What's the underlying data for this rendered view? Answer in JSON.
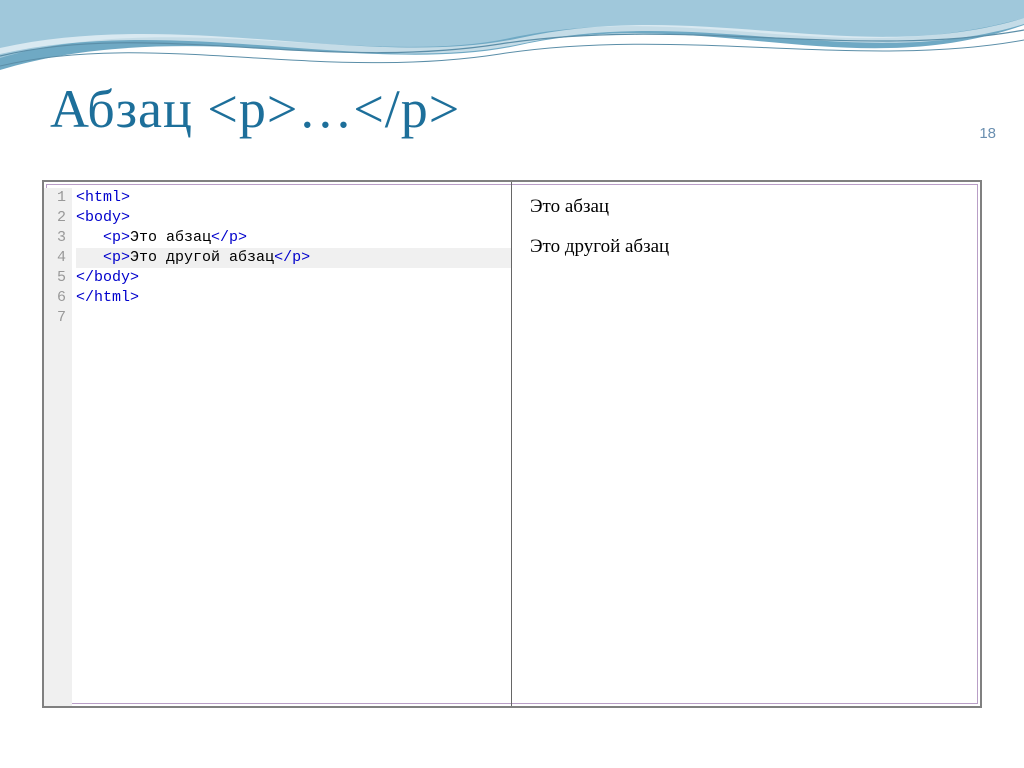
{
  "title": "Абзац  <p>…</p>",
  "page_number": "18",
  "code": {
    "line_numbers": [
      "1",
      "2",
      "3",
      "4",
      "5",
      "6",
      "7"
    ],
    "lines": [
      {
        "hl": false,
        "spans": [
          {
            "cls": "tag",
            "t": "<html>"
          }
        ]
      },
      {
        "hl": false,
        "spans": [
          {
            "cls": "tag",
            "t": "<body>"
          }
        ]
      },
      {
        "hl": false,
        "spans": [
          {
            "cls": "txt",
            "t": "   "
          },
          {
            "cls": "tag",
            "t": "<p>"
          },
          {
            "cls": "txt",
            "t": "Это абзац"
          },
          {
            "cls": "tag",
            "t": "</p>"
          }
        ]
      },
      {
        "hl": true,
        "spans": [
          {
            "cls": "txt",
            "t": "   "
          },
          {
            "cls": "tag",
            "t": "<p>"
          },
          {
            "cls": "txt",
            "t": "Это другой абзац"
          },
          {
            "cls": "tag",
            "t": "</p>"
          }
        ]
      },
      {
        "hl": false,
        "spans": [
          {
            "cls": "tag",
            "t": "</body>"
          }
        ]
      },
      {
        "hl": false,
        "spans": [
          {
            "cls": "tag",
            "t": "</html>"
          }
        ]
      },
      {
        "hl": false,
        "spans": [
          {
            "cls": "txt",
            "t": ""
          }
        ]
      }
    ]
  },
  "preview": {
    "p1": "Это абзац",
    "p2": "Это другой абзац"
  }
}
